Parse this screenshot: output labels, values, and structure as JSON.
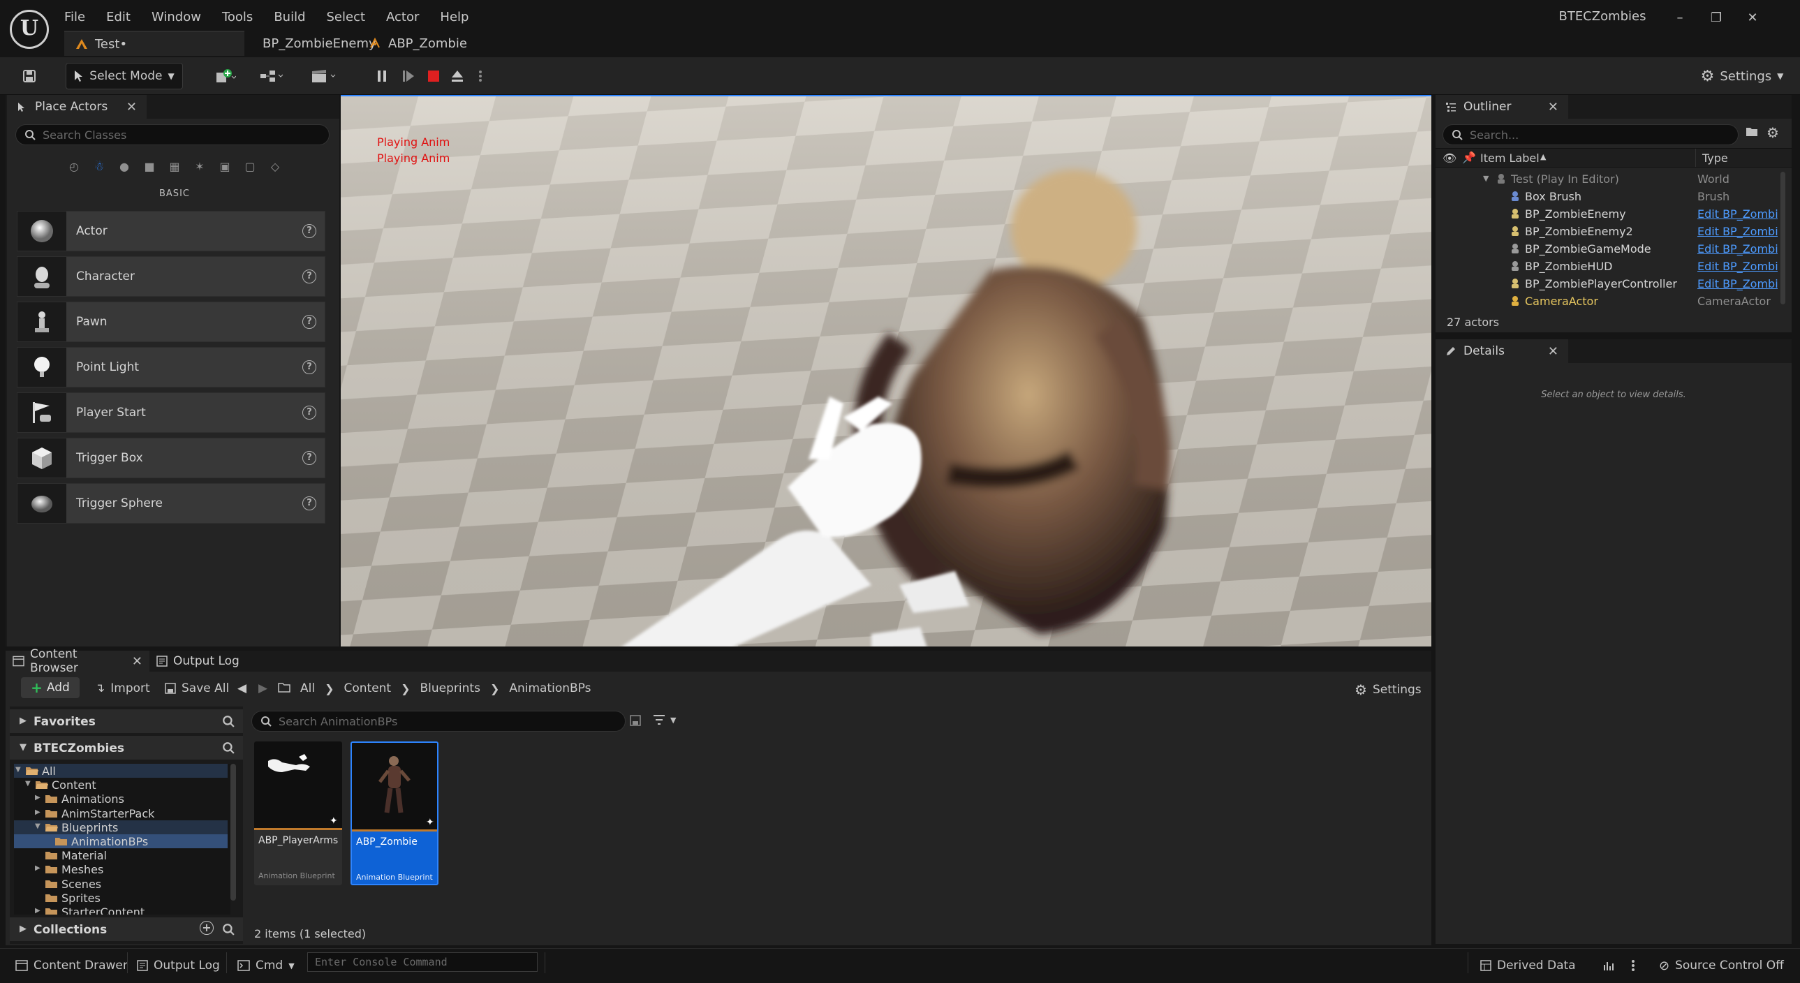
{
  "app": {
    "project_title": "BTECZombies"
  },
  "menu": [
    "File",
    "Edit",
    "Window",
    "Tools",
    "Build",
    "Select",
    "Actor",
    "Help"
  ],
  "doc_tabs": [
    {
      "label": "Test•"
    },
    {
      "label": "BP_ZombieEnemy"
    },
    {
      "label": "ABP_Zombie"
    }
  ],
  "toolbar": {
    "select_mode": "Select Mode",
    "settings": "Settings"
  },
  "place_actors": {
    "title": "Place Actors",
    "search_placeholder": "Search Classes",
    "category": "BASIC",
    "items": [
      "Actor",
      "Character",
      "Pawn",
      "Point Light",
      "Player Start",
      "Trigger Box",
      "Trigger Sphere"
    ]
  },
  "viewport": {
    "debug_lines": [
      "Playing Anim",
      "Playing Anim"
    ]
  },
  "outliner": {
    "title": "Outliner",
    "search_placeholder": "Search...",
    "col_label": "Item Label",
    "col_type": "Type",
    "rows": [
      {
        "name": "Test (Play In Editor)",
        "type": "World",
        "link": false
      },
      {
        "name": "Box Brush",
        "type": "Brush",
        "link": false
      },
      {
        "name": "BP_ZombieEnemy",
        "type": "Edit BP_ZombieEnemy",
        "link": true
      },
      {
        "name": "BP_ZombieEnemy2",
        "type": "Edit BP_ZombieEnemy",
        "link": true
      },
      {
        "name": "BP_ZombieGameMode",
        "type": "Edit BP_ZombieGameMode",
        "link": true
      },
      {
        "name": "BP_ZombieHUD",
        "type": "Edit BP_ZombieHUD",
        "link": true
      },
      {
        "name": "BP_ZombiePlayerController",
        "type": "Edit BP_ZombiePlayerController",
        "link": true
      },
      {
        "name": "CameraActor",
        "type": "CameraActor",
        "link": false
      }
    ],
    "count": "27 actors"
  },
  "details": {
    "title": "Details",
    "empty_text": "Select an object to view details."
  },
  "content_browser": {
    "tab1": "Content Browser",
    "tab2": "Output Log",
    "add": "Add",
    "import": "Import",
    "save_all": "Save All",
    "breadcrumb": [
      "All",
      "Content",
      "Blueprints",
      "AnimationBPs"
    ],
    "settings": "Settings",
    "favorites": "Favorites",
    "project": "BTECZombies",
    "collections": "Collections",
    "tree": [
      "All",
      "Content",
      "Animations",
      "AnimStarterPack",
      "Blueprints",
      "AnimationBPs",
      "Material",
      "Meshes",
      "Scenes",
      "Sprites",
      "StarterContent"
    ],
    "search_placeholder": "Search AnimationBPs",
    "assets": [
      {
        "name": "ABP_PlayerArms",
        "type": "Animation Blueprint"
      },
      {
        "name": "ABP_Zombie",
        "type": "Animation Blueprint"
      }
    ],
    "items_count": "2 items (1 selected)"
  },
  "status_bar": {
    "content_drawer": "Content Drawer",
    "output_log": "Output Log",
    "cmd": "Cmd",
    "console_placeholder": "Enter Console Command",
    "derived_data": "Derived Data",
    "source_control": "Source Control Off"
  },
  "colors": {
    "accent": "#2d84ff",
    "link": "#4d9bff",
    "panel": "#242424",
    "debug_text": "#e01010"
  }
}
